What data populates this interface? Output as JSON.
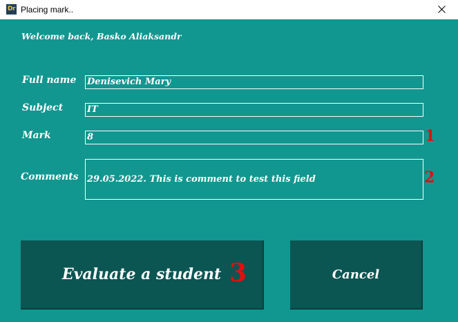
{
  "window": {
    "title": "Placing mark..",
    "icon_text": "Dr",
    "close_icon": "close-icon"
  },
  "welcome": "Welcome back, Basko Aliaksandr",
  "form": {
    "full_name_label": "Full name",
    "full_name_value": "Denisevich Mary",
    "subject_label": "Subject",
    "subject_value": "IT",
    "mark_label": "Mark",
    "mark_value": "8",
    "comments_label": "Comments",
    "comments_value": "29.05.2022. This is comment to test this field"
  },
  "markers": {
    "one": "1",
    "two": "2",
    "three": "3"
  },
  "buttons": {
    "evaluate_label": "Evaluate a student",
    "cancel_label": "Cancel"
  },
  "colors": {
    "background": "#129690",
    "button": "#0b5552",
    "marker": "#e01010",
    "text": "#ffffff"
  }
}
